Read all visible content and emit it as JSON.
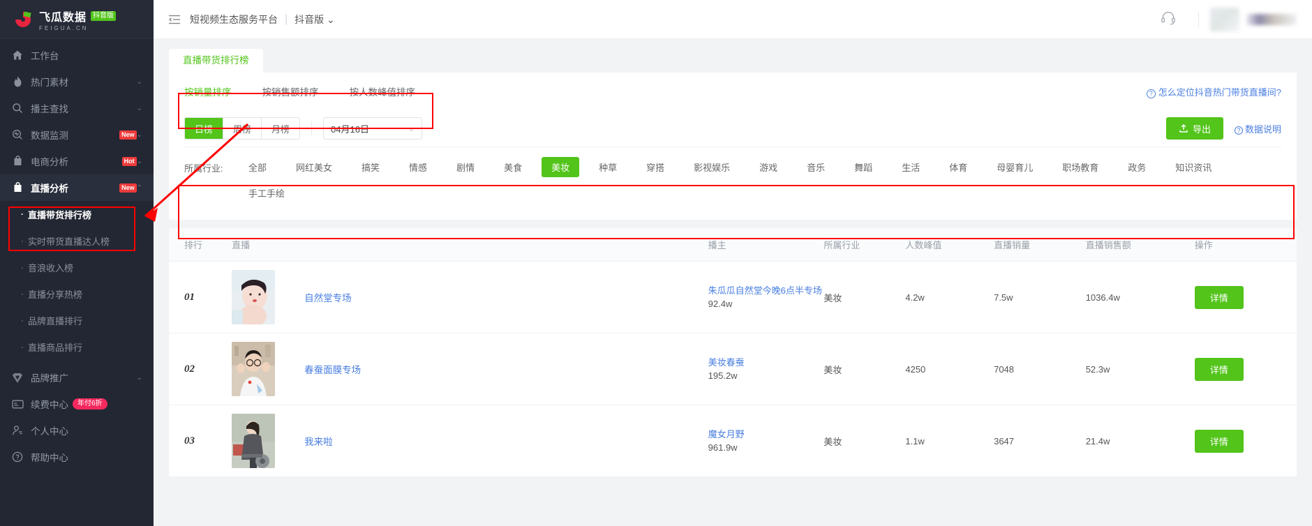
{
  "brand": {
    "name": "飞瓜数据",
    "badge": "抖音版",
    "sub": "FEIGUA.CN"
  },
  "colors": {
    "accent_green": "#52c41a",
    "link_blue": "#4a7fe0",
    "sidebar_bg": "#232733",
    "tag_red": "#ef3b3b",
    "annotation_red": "#ff0000"
  },
  "sidebar": {
    "items": [
      {
        "label": "工作台",
        "icon": "home-icon",
        "tag": "",
        "chevron": ""
      },
      {
        "label": "热门素材",
        "icon": "fire-icon",
        "tag": "",
        "chevron": "⌄"
      },
      {
        "label": "播主查找",
        "icon": "search-icon",
        "tag": "",
        "chevron": "⌄"
      },
      {
        "label": "数据监测",
        "icon": "monitor-icon",
        "tag": "New",
        "chevron": "⌄"
      },
      {
        "label": "电商分析",
        "icon": "bag-icon",
        "tag": "Hot",
        "chevron": "⌄"
      },
      {
        "label": "直播分析",
        "icon": "bag-icon",
        "tag": "New",
        "chevron": "⌃"
      }
    ],
    "sub_items": [
      {
        "label": "直播带货排行榜",
        "active": true
      },
      {
        "label": "实时带货直播达人榜",
        "active": false
      },
      {
        "label": "音浪收入榜",
        "active": false
      },
      {
        "label": "直播分享热榜",
        "active": false
      },
      {
        "label": "品牌直播排行",
        "active": false
      },
      {
        "label": "直播商品排行",
        "active": false
      }
    ],
    "bottom_items": [
      {
        "label": "品牌推广",
        "icon": "diamond-icon",
        "tag": "",
        "chevron": "⌄"
      },
      {
        "label": "续费中心",
        "icon": "card-icon",
        "tag": "年付6折",
        "chevron": ""
      },
      {
        "label": "个人中心",
        "icon": "user-icon",
        "tag": "",
        "chevron": ""
      },
      {
        "label": "帮助中心",
        "icon": "help-icon",
        "tag": "",
        "chevron": ""
      }
    ]
  },
  "topbar": {
    "collapse_icon": "collapse-menu-icon",
    "title": "短视频生态服务平台",
    "separator": "|",
    "version": "抖音版",
    "version_chevron": "⌄",
    "headset_icon": "headset-icon"
  },
  "tabs": [
    {
      "label": "直播带货排行榜",
      "active": true
    }
  ],
  "subtabs": [
    {
      "label": "按销量排序",
      "active": true
    },
    {
      "label": "按销售额排序",
      "active": false
    },
    {
      "label": "按人数峰值排序",
      "active": false
    }
  ],
  "help_link": "怎么定位抖音热门带货直播间?",
  "period": {
    "options": [
      {
        "label": "日榜",
        "active": true
      },
      {
        "label": "周榜",
        "active": false
      },
      {
        "label": "月榜",
        "active": false
      }
    ],
    "date_value": "04月16日",
    "date_chevron": "⌄"
  },
  "export_button": "导出",
  "data_note": "数据说明",
  "industry": {
    "label": "所属行业:",
    "items": [
      {
        "label": "全部",
        "active": false
      },
      {
        "label": "网红美女",
        "active": false
      },
      {
        "label": "搞笑",
        "active": false
      },
      {
        "label": "情感",
        "active": false
      },
      {
        "label": "剧情",
        "active": false
      },
      {
        "label": "美食",
        "active": false
      },
      {
        "label": "美妆",
        "active": true
      },
      {
        "label": "种草",
        "active": false
      },
      {
        "label": "穿搭",
        "active": false
      },
      {
        "label": "影视娱乐",
        "active": false
      },
      {
        "label": "游戏",
        "active": false
      },
      {
        "label": "音乐",
        "active": false
      },
      {
        "label": "舞蹈",
        "active": false
      },
      {
        "label": "生活",
        "active": false
      },
      {
        "label": "体育",
        "active": false
      },
      {
        "label": "母婴育儿",
        "active": false
      },
      {
        "label": "职场教育",
        "active": false
      },
      {
        "label": "政务",
        "active": false
      },
      {
        "label": "知识资讯",
        "active": false
      },
      {
        "label": "手工手绘",
        "active": false
      }
    ]
  },
  "table": {
    "headers": [
      "排行",
      "直播",
      "播主",
      "所属行业",
      "人数峰值",
      "直播销量",
      "直播销售额",
      "操作"
    ],
    "action_label": "详情",
    "rows": [
      {
        "rank": "01",
        "live_name": "自然堂专场",
        "host_name": "朱瓜瓜自然堂今晚6点半专场",
        "host_fans": "92.4w",
        "industry": "美妆",
        "peak": "4.2w",
        "volume": "7.5w",
        "amount": "1036.4w"
      },
      {
        "rank": "02",
        "live_name": "春蚕面膜专场",
        "host_name": "美妆春蚕",
        "host_fans": "195.2w",
        "industry": "美妆",
        "peak": "4250",
        "volume": "7048",
        "amount": "52.3w"
      },
      {
        "rank": "03",
        "live_name": "我来啦",
        "host_name": "魔女月野",
        "host_fans": "961.9w",
        "industry": "美妆",
        "peak": "1.1w",
        "volume": "3647",
        "amount": "21.4w"
      }
    ]
  }
}
